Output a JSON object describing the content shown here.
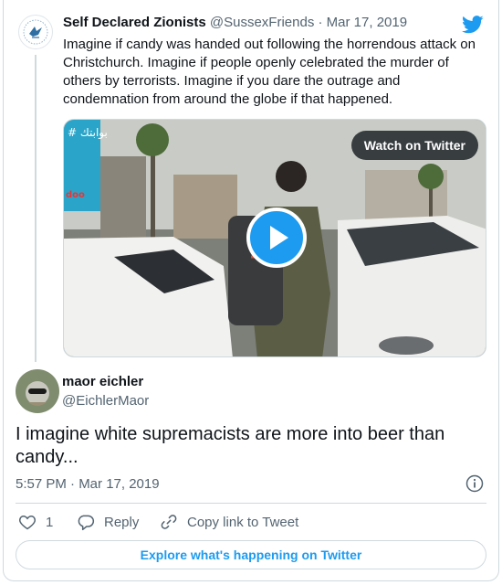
{
  "parent_tweet": {
    "author_name": "Self Declared Zionists",
    "handle": "@SussexFriends",
    "separator": "·",
    "date": "Mar 17, 2019",
    "text": "Imagine if candy was handed out following the horrendous attack on Christchurch. Imagine if people openly celebrated the murder of others by terrorists. Imagine if you dare the outrage and condemnation from around the globe if that happened.",
    "media": {
      "watch_label": "Watch on Twitter",
      "sign_text": "# بوابتك",
      "sign_text2": "doo"
    }
  },
  "reply_tweet": {
    "author_name": "maor eichler",
    "handle": "@EichlerMaor",
    "text": "I imagine white supremacists are more into beer than candy...",
    "timestamp": "5:57 PM · Mar 17, 2019"
  },
  "actions": {
    "like_count": "1",
    "reply_label": "Reply",
    "copy_label": "Copy link to Tweet"
  },
  "explore_label": "Explore what's happening on Twitter",
  "colors": {
    "accent": "#1d9bf0",
    "text_primary": "#0f1419",
    "text_secondary": "#536471",
    "border": "#cfd9de"
  },
  "icons": [
    "twitter-bird-icon",
    "play-icon",
    "info-icon",
    "heart-icon",
    "reply-bubble-icon",
    "link-icon"
  ]
}
